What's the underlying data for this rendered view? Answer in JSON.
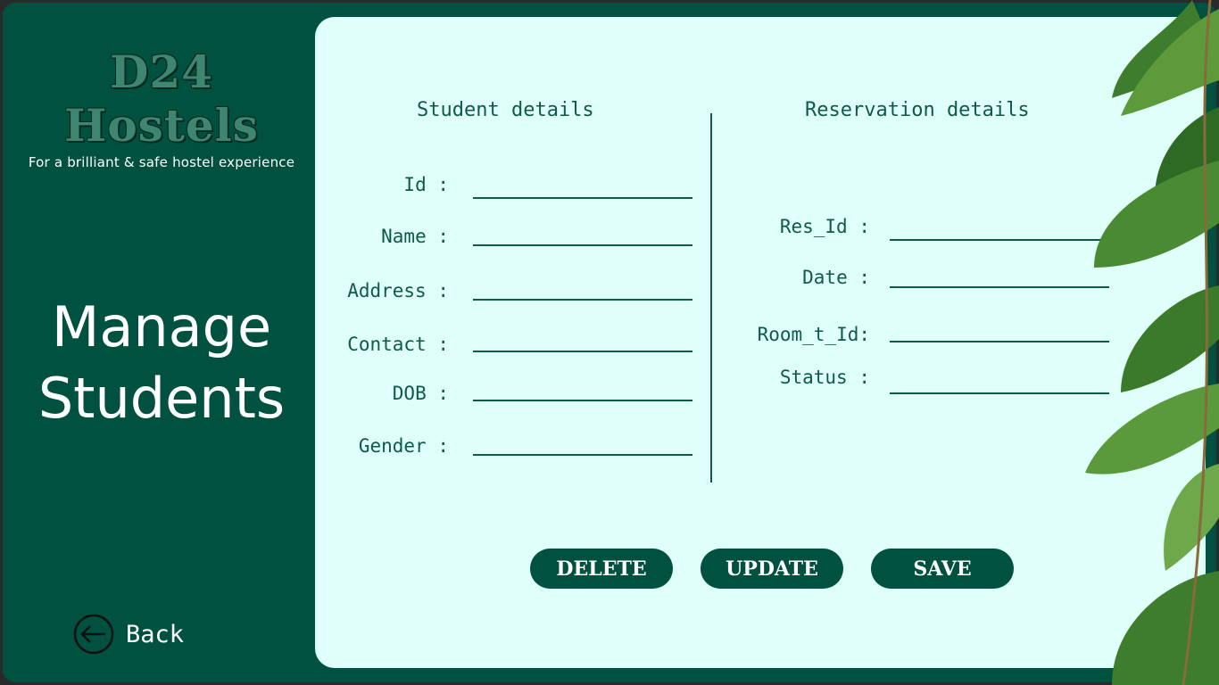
{
  "brand": {
    "logo": "D24 Hostels",
    "tagline": "For a brilliant & safe hostel experience"
  },
  "sidebar": {
    "title_line1": "Manage",
    "title_line2": "Students",
    "back_label": "Back"
  },
  "student": {
    "title": "Student details",
    "fields": [
      {
        "label": "Id :",
        "value": ""
      },
      {
        "label": "Name :",
        "value": ""
      },
      {
        "label": "Address :",
        "value": ""
      },
      {
        "label": "Contact :",
        "value": ""
      },
      {
        "label": "DOB :",
        "value": ""
      },
      {
        "label": "Gender :",
        "value": ""
      }
    ]
  },
  "reservation": {
    "title": "Reservation details",
    "fields": [
      {
        "label": "Res_Id :",
        "value": ""
      },
      {
        "label": "Date :",
        "value": ""
      },
      {
        "label": "Room_t_Id:",
        "value": ""
      },
      {
        "label": "Status :",
        "value": ""
      }
    ]
  },
  "actions": {
    "delete": "DELETE",
    "update": "UPDATE",
    "save": "SAVE"
  },
  "colors": {
    "primary": "#005140",
    "panel": "#dffff9",
    "accent_text": "#0f5a48",
    "logo": "#3e8670"
  }
}
